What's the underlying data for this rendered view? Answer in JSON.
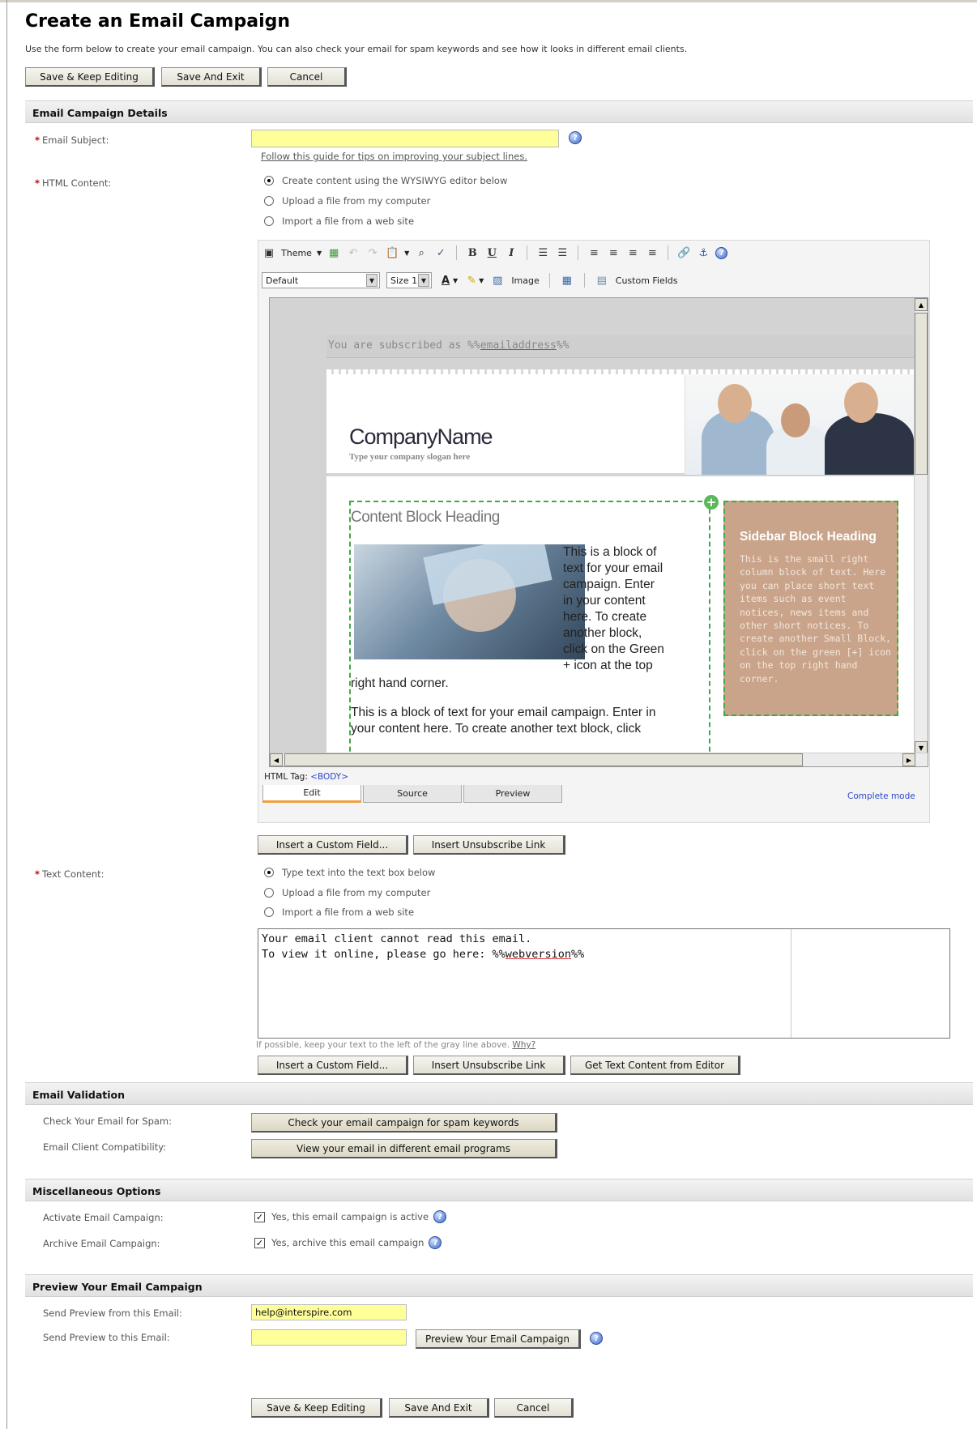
{
  "page": {
    "title": "Create an Email Campaign",
    "intro": "Use the form below to create your email campaign. You can also check your email for spam keywords and see how it looks in different email clients."
  },
  "top_buttons": {
    "save_keep": "Save & Keep Editing",
    "save_exit": "Save And Exit",
    "cancel": "Cancel"
  },
  "details": {
    "section_title": "Email Campaign Details",
    "subject_label": "Email Subject:",
    "subject_value": "",
    "subject_guide": "Follow this guide for tips on improving your subject lines.",
    "html_label": "HTML Content:",
    "html_options": [
      "Create content using the WYSIWYG editor below",
      "Upload a file from my computer",
      "Import a file from a web site"
    ],
    "html_selected": 0
  },
  "editor": {
    "theme_label": "Theme",
    "font_select": "Default",
    "size_select": "Size 1",
    "image_label": "Image",
    "custom_fields_label": "Custom Fields",
    "html_tag_label": "HTML Tag:",
    "html_tag_value": "<BODY>",
    "tabs": [
      "Edit",
      "Source",
      "Preview"
    ],
    "active_tab": "Edit",
    "mode_link": "Complete mode",
    "email": {
      "subscribed_prefix": "You are subscribed as %%",
      "subscribed_var": "emailaddress",
      "subscribed_suffix": "%%",
      "company_name": "CompanyName",
      "slogan": "Type your company slogan here",
      "content_heading": "Content Block Heading",
      "block_text_1_lines": [
        "This is a block of",
        "text for your email",
        "campaign. Enter",
        "in your content",
        "here. To create",
        "another block,",
        "click on the Green",
        "+ icon at the top"
      ],
      "block_text_1_tail": "right hand corner.",
      "block_text_2_lines": [
        "This is a block of text for your email campaign. Enter in",
        "your content here. To create another text block, click"
      ],
      "sidebar_heading": "Sidebar Block Heading",
      "sidebar_text_lines": [
        "This is the small right",
        "column block of text. Here",
        "you can place short text",
        "items such as event",
        "notices, news items and",
        "other short notices. To",
        "create another Small Block,",
        "click on the green [+] icon",
        "on the top right hand",
        "corner."
      ]
    }
  },
  "mid_buttons": {
    "insert_custom": "Insert a Custom Field...",
    "insert_unsub": "Insert Unsubscribe Link"
  },
  "text_content": {
    "label": "Text Content:",
    "options": [
      "Type text into the text box below",
      "Upload a file from my computer",
      "Import a file from a web site"
    ],
    "selected": 0,
    "line1": "Your email client cannot read this email.",
    "line2_prefix": "To view it online, please go here: %%",
    "line2_var": "webversion",
    "line2_suffix": "%%",
    "hint": "If possible, keep your text to the left of the gray line above.",
    "hint_link": "Why?",
    "insert_custom": "Insert a Custom Field...",
    "insert_unsub": "Insert Unsubscribe Link",
    "get_text": "Get Text Content from Editor"
  },
  "validation": {
    "section_title": "Email Validation",
    "spam_label": "Check Your Email for Spam:",
    "spam_button": "Check your email campaign for spam keywords",
    "client_label": "Email Client Compatibility:",
    "client_button": "View your email in different email programs"
  },
  "misc": {
    "section_title": "Miscellaneous Options",
    "activate_label": "Activate Email Campaign:",
    "activate_text": "Yes, this email campaign is active",
    "activate_checked": true,
    "archive_label": "Archive Email Campaign:",
    "archive_text": "Yes, archive this email campaign",
    "archive_checked": true
  },
  "preview": {
    "section_title": "Preview Your Email Campaign",
    "from_label": "Send Preview from this Email:",
    "from_value": "help@interspire.com",
    "to_label": "Send Preview to this Email:",
    "to_value": "",
    "preview_button": "Preview Your Email Campaign"
  },
  "bottom_buttons": {
    "save_keep": "Save & Keep Editing",
    "save_exit": "Save And Exit",
    "cancel": "Cancel"
  },
  "colors": {
    "field_bg": "#ffff99",
    "required_star": "#cc0000",
    "sidebar_bg": "#c9a48a",
    "block_border": "#3faa3f"
  }
}
